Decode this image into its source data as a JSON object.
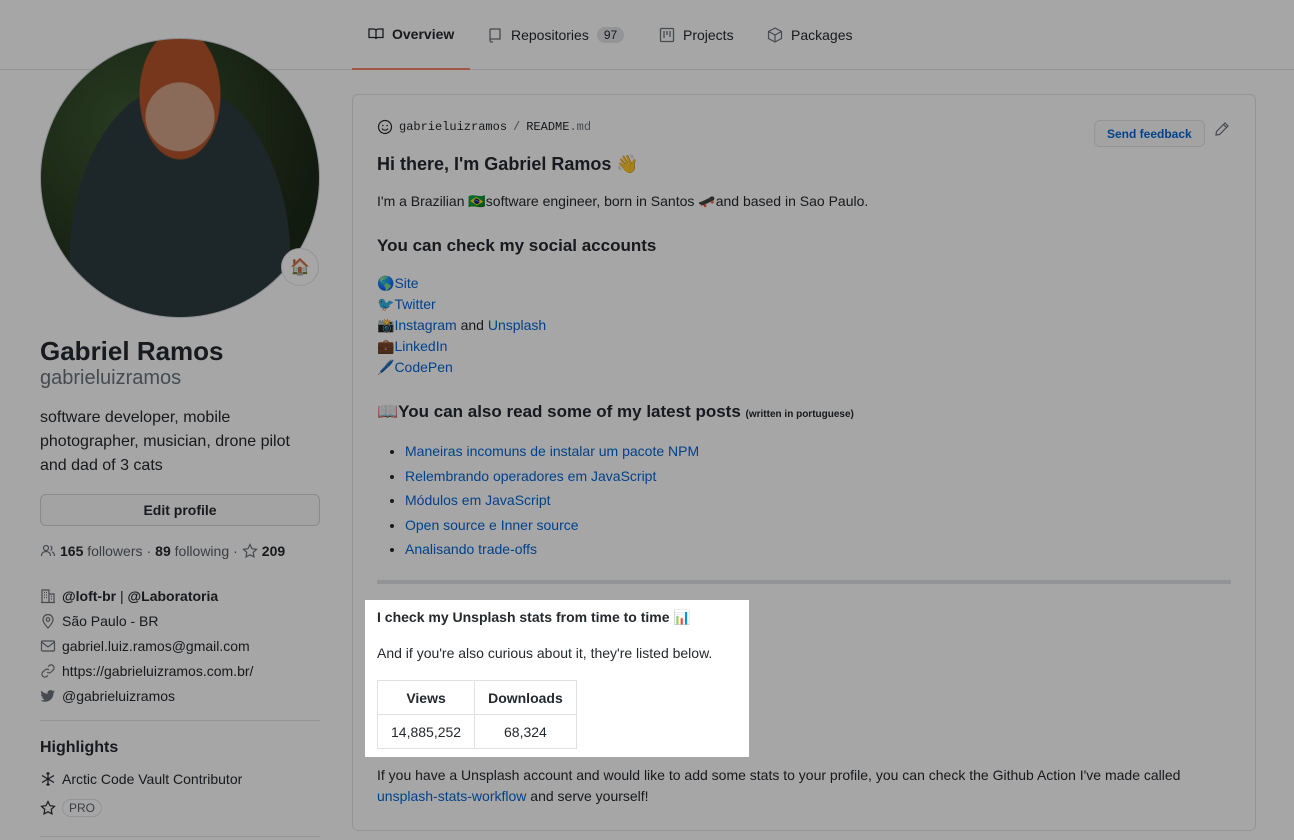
{
  "tabs": [
    {
      "label": "Overview",
      "icon": "book-icon",
      "selected": true
    },
    {
      "label": "Repositories",
      "icon": "repo-icon",
      "count": "97"
    },
    {
      "label": "Projects",
      "icon": "project-icon"
    },
    {
      "label": "Packages",
      "icon": "package-icon"
    }
  ],
  "profile": {
    "name": "Gabriel Ramos",
    "login": "gabrieluizramos",
    "status_emoji": "🏠",
    "bio": "software developer, mobile photographer, musician, drone pilot and dad of 3 cats",
    "edit_label": "Edit profile",
    "followers_count": "165",
    "followers_label": "followers",
    "sep": "·",
    "following_count": "89",
    "following_label": "following",
    "stars_count": "209",
    "org1": "@loft-br",
    "org_sep": "|",
    "org2": "@Laboratoria",
    "location": "São Paulo - BR",
    "email": "gabriel.luiz.ramos@gmail.com",
    "website": "https://gabrieluizramos.com.br/",
    "twitter": "@gabrieluizramos"
  },
  "highlights": {
    "title": "Highlights",
    "arctic": "Arctic Code Vault Contributor",
    "pro": "PRO"
  },
  "readme": {
    "path_user": "gabrieluizramos",
    "path_sep": "/",
    "path_file": "README",
    "path_ext": ".md",
    "feedback_label": "Send feedback",
    "greeting": "Hi there, I'm Gabriel Ramos 👋",
    "intro": "I'm a Brazilian 🇧🇷software engineer, born in Santos 🛹and based in Sao Paulo.",
    "social_heading": "You can check my social accounts",
    "social": {
      "site_emoji": "🌎",
      "site": "Site",
      "twitter_emoji": "🐦",
      "twitter": "Twitter",
      "insta_emoji": "📸",
      "instagram": "Instagram",
      "and": " and ",
      "unsplash": "Unsplash",
      "linkedin_emoji": "💼",
      "linkedin": "LinkedIn",
      "codepen_emoji": "🖊️",
      "codepen": "CodePen"
    },
    "posts_heading": "📖You can also read some of my latest posts",
    "posts_note": "(written in portuguese)",
    "posts": [
      "Maneiras incomuns de instalar um pacote NPM",
      "Relembrando operadores em JavaScript",
      "Módulos em JavaScript",
      "Open source e Inner source",
      "Analisando trade-offs"
    ],
    "stats_heading": "I check my Unsplash stats from time to time 📊",
    "stats_text": "And if you're also curious about it, they're listed below.",
    "stats_headers": [
      "Views",
      "Downloads"
    ],
    "stats_values": [
      "14,885,252",
      "68,324"
    ],
    "footer_text": "If you have a Unsplash account and would like to add some stats to your profile, you can check the Github Action I've made called",
    "footer_link": "unsplash-stats-workflow",
    "footer_tail": " and serve yourself!"
  }
}
